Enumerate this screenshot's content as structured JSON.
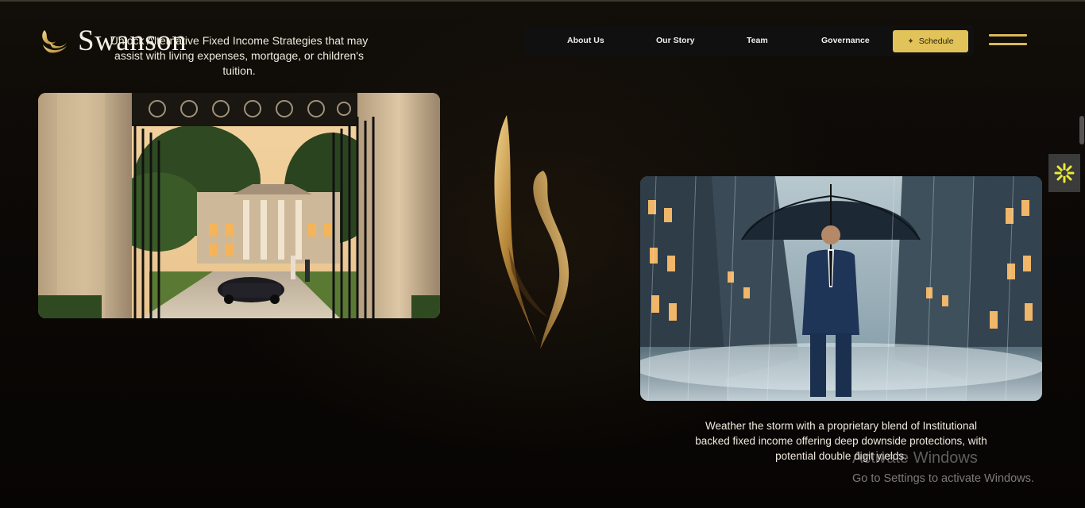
{
  "brand": {
    "name": "Swanson",
    "logo_icon": "swan-logo-icon",
    "accent_color": "#d9b85e"
  },
  "hero": {
    "tagline": "Unlock Alternative Fixed Income Strategies that may assist with living expenses, mortgage, or children's tuition."
  },
  "nav": {
    "items": [
      {
        "label": "About Us"
      },
      {
        "label": "Our Story"
      },
      {
        "label": "Team"
      },
      {
        "label": "Governance"
      }
    ],
    "schedule_label": "Schedule",
    "schedule_icon": "sparkle-icon",
    "schedule_color": "#e2c35a",
    "menu_icon": "hamburger-menu-icon"
  },
  "images": {
    "left": "mansion-gate-photo",
    "right": "businessman-umbrella-storm-photo",
    "center": "gold-swan-sculpture"
  },
  "feature": {
    "caption": "Weather the storm with a proprietary blend of Institutional backed fixed income offering deep downside protections, with potential double digit yields."
  },
  "widget": {
    "icon": "accessibility-sparkle-icon"
  },
  "watermark": {
    "title": "Activate Windows",
    "subtitle": "Go to Settings to activate Windows."
  }
}
